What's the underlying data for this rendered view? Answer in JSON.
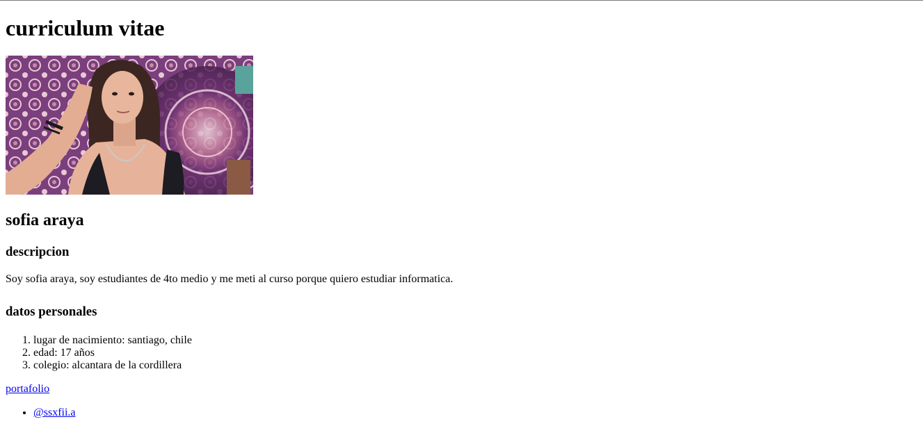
{
  "page": {
    "title": "curriculum vitae",
    "name": "sofia araya",
    "description_heading": "descripcion",
    "description_text": "Soy sofia araya, soy estudiantes de 4to medio y me meti al curso porque quiero estudiar informatica.",
    "personal_heading": "datos personales",
    "personal_items": [
      "lugar de nacimiento: santiago, chile",
      "edad: 17 años",
      "colegio: alcantara de la cordillera"
    ],
    "portfolio_link": "portafolio",
    "social_links": [
      "@ssxfii.a"
    ]
  },
  "photo": {
    "subject": "person-portrait",
    "background_colors": [
      "#6b3a73",
      "#c98aa8",
      "#e8c9d4",
      "#3a2a3a"
    ]
  },
  "colors": {
    "link": "#0000ee",
    "text": "#000000",
    "background": "#ffffff"
  }
}
